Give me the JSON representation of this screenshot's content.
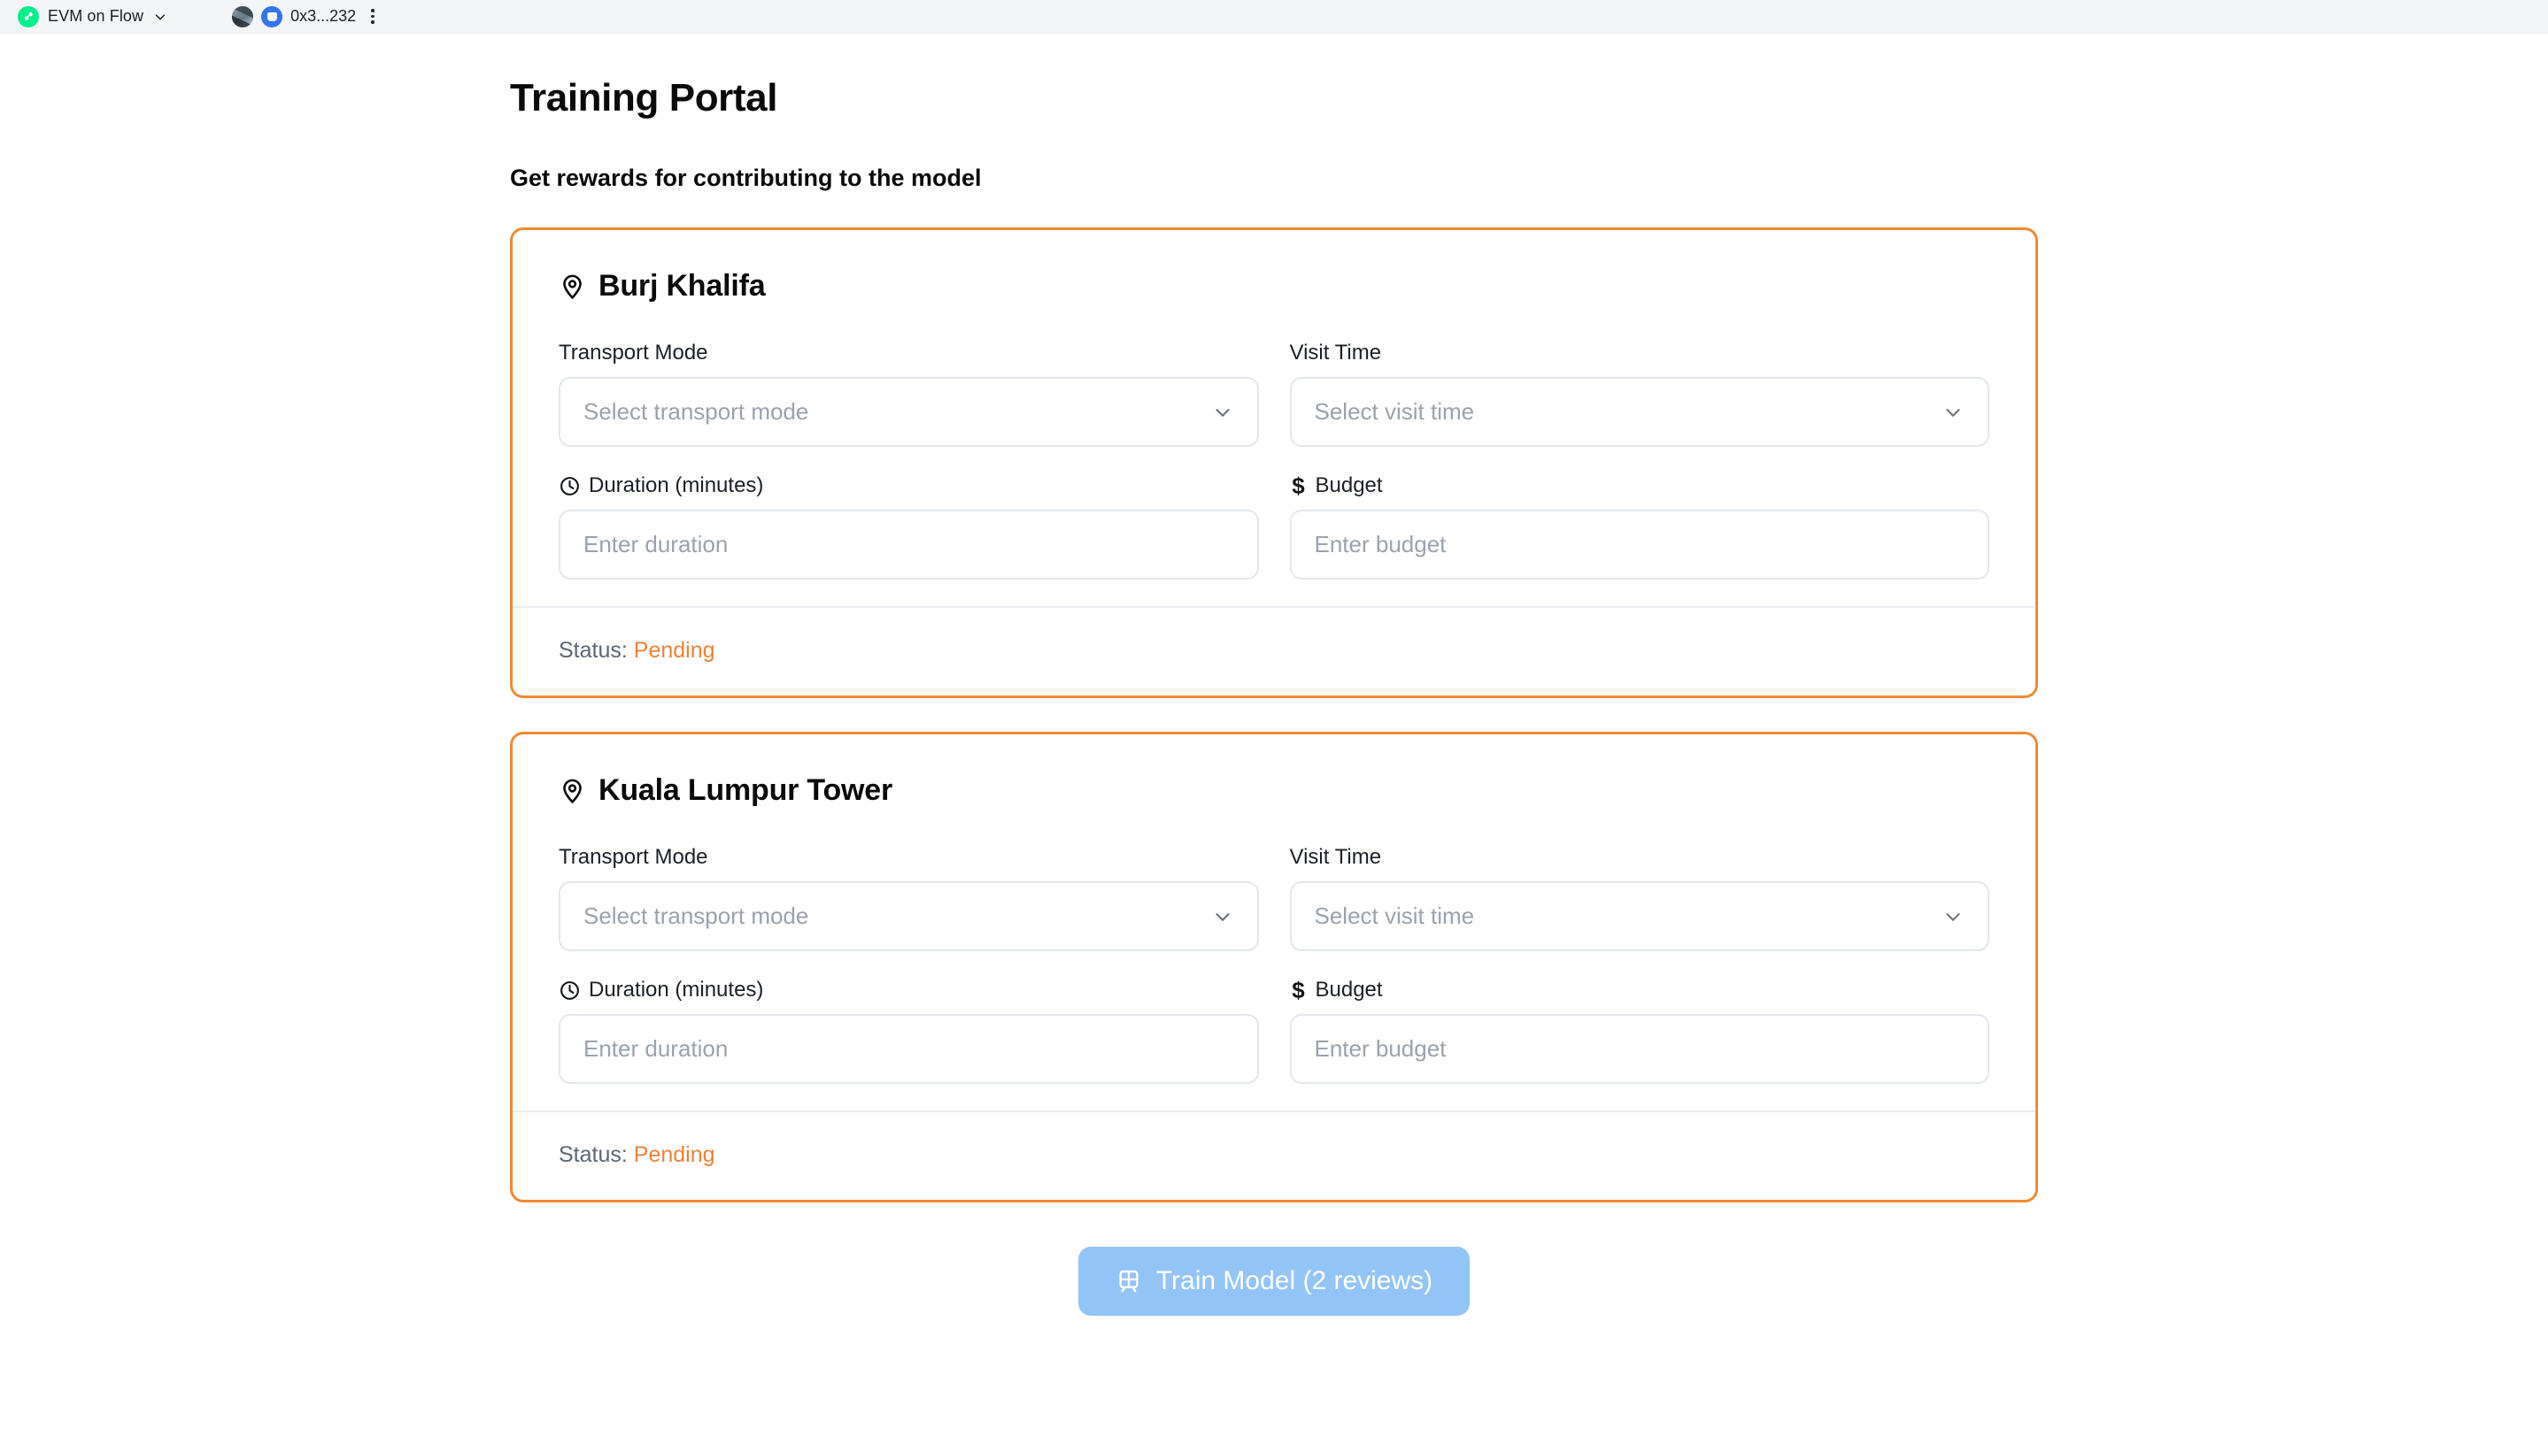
{
  "topbar": {
    "network_icon": "flow-logo-icon",
    "network_label": "EVM on Flow",
    "network_chevron_icon": "chevron-down-icon",
    "avatar_icon": "account-avatar",
    "wallet_icon": "wallet-badge-icon",
    "account_address": "0x3...232",
    "menu_icon": "kebab-menu-icon"
  },
  "header": {
    "title": "Training Portal",
    "subtitle": "Get rewards for contributing to the model"
  },
  "labels": {
    "transport_mode": "Transport Mode",
    "visit_time": "Visit Time",
    "duration": "Duration (minutes)",
    "budget": "Budget",
    "status_prefix": "Status:",
    "pin_icon": "map-pin-icon",
    "clock_icon": "clock-icon",
    "dollar_icon": "$",
    "chevron_icon": "chevron-down-icon"
  },
  "placeholders": {
    "transport_mode": "Select transport mode",
    "visit_time": "Select visit time",
    "duration": "Enter duration",
    "budget": "Enter budget"
  },
  "cards": [
    {
      "name": "Burj Khalifa",
      "transport_mode_value": "Select transport mode",
      "visit_time_value": "Select visit time",
      "duration_value": "Enter duration",
      "budget_value": "Enter budget",
      "status": "Pending"
    },
    {
      "name": "Kuala Lumpur Tower",
      "transport_mode_value": "Select transport mode",
      "visit_time_value": "Select visit time",
      "duration_value": "Enter duration",
      "budget_value": "Enter budget",
      "status": "Pending"
    }
  ],
  "action": {
    "train_button_label": "Train Model (2 reviews)",
    "train_button_icon": "train-icon"
  },
  "colors": {
    "card_border": "#f08a34",
    "status_pending": "#ef8135",
    "button_disabled": "#93c4f7",
    "flow_green": "#00ef8b",
    "wallet_blue": "#3375ec"
  }
}
